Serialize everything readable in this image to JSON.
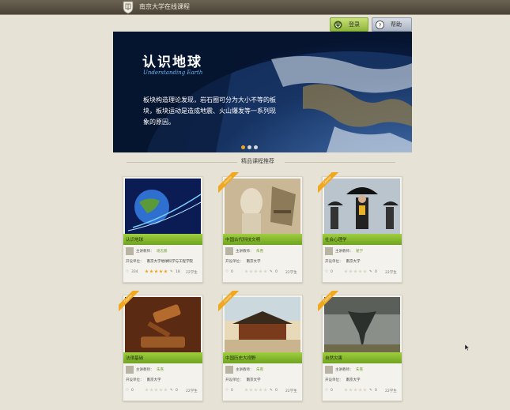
{
  "header": {
    "site_title": "南京大学在线课程",
    "login_label": "登录",
    "help_label": "帮助"
  },
  "banner": {
    "title": "认识地球",
    "subtitle": "Understanding Earth",
    "text": "板块构造理论发现，岩石圈可分为大小不等的板块，板块运动是造成地震、火山爆发等一系列现象的原因。",
    "slides": 3,
    "active_slide": 0
  },
  "section_title": "精品课程推荐",
  "course_labels": {
    "teacher": "主讲教师：",
    "unit": "开设单位："
  },
  "courses": [
    {
      "name": "认识地球",
      "teacher": "谢志鹏",
      "unit": "南京大学地球科学与工程学院",
      "likes": "334",
      "rating": 5,
      "count": "18",
      "tag": "22学生",
      "badge": "",
      "image": "earth"
    },
    {
      "name": "中国古代科技文明",
      "teacher": "朱熹",
      "unit": "南京大学",
      "likes": "0",
      "rating": 0,
      "count": "0",
      "tag": "22学生",
      "badge": "Course",
      "image": "statue"
    },
    {
      "name": "社会心理学",
      "teacher": "翟学",
      "unit": "南京大学",
      "likes": "0",
      "rating": 0,
      "count": "0",
      "tag": "22学生",
      "badge": "Course",
      "image": "umbrella"
    },
    {
      "name": "法律基础",
      "teacher": "朱熹",
      "unit": "南京大学",
      "likes": "0",
      "rating": 0,
      "count": "0",
      "tag": "22学生",
      "badge": "Course",
      "image": "gavel"
    },
    {
      "name": "中国历史大视野",
      "teacher": "朱熹",
      "unit": "南京大学",
      "likes": "0",
      "rating": 0,
      "count": "0",
      "tag": "22学生",
      "badge": "Course",
      "image": "palace"
    },
    {
      "name": "自然灾害",
      "teacher": "朱熹",
      "unit": "南京大学",
      "likes": "0",
      "rating": 0,
      "count": "0",
      "tag": "22学生",
      "badge": "Course",
      "image": "tornado"
    }
  ],
  "colors": {
    "background": "#e6e2d6",
    "accent_green": "#8fb63a",
    "ribbon_orange": "#f2a81e",
    "star": "#f0a21f"
  },
  "icons": {
    "logo": "university-shield-icon",
    "login": "power-icon",
    "help": "question-icon",
    "cursor": "mouse-pointer-icon"
  }
}
